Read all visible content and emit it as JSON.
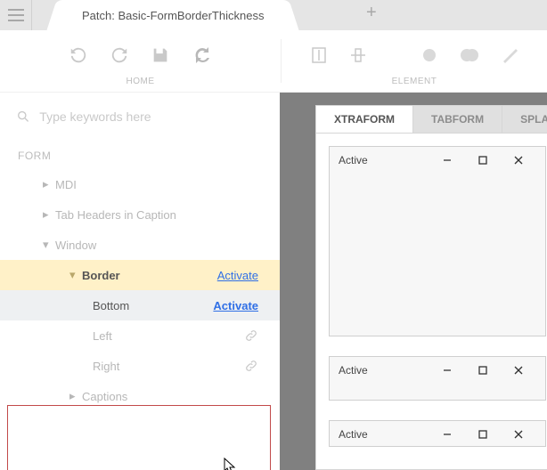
{
  "title_tab": "Patch: Basic-FormBorderThickness",
  "ribbon": {
    "home": "HOME",
    "element": "ELEMENT"
  },
  "search": {
    "placeholder": "Type keywords here"
  },
  "tree": {
    "section": "FORM",
    "mdi": "MDI",
    "tabheaders": "Tab Headers in Caption",
    "window": "Window",
    "border": "Border",
    "border_action": "Activate",
    "bottom": "Bottom",
    "bottom_action": "Activate",
    "left": "Left",
    "right": "Right",
    "captions": "Captions"
  },
  "preview": {
    "tabs": {
      "xtraform": "XTRAFORM",
      "tabform": "TABFORM",
      "splash": "SPLAS"
    },
    "active_label": "Active"
  }
}
